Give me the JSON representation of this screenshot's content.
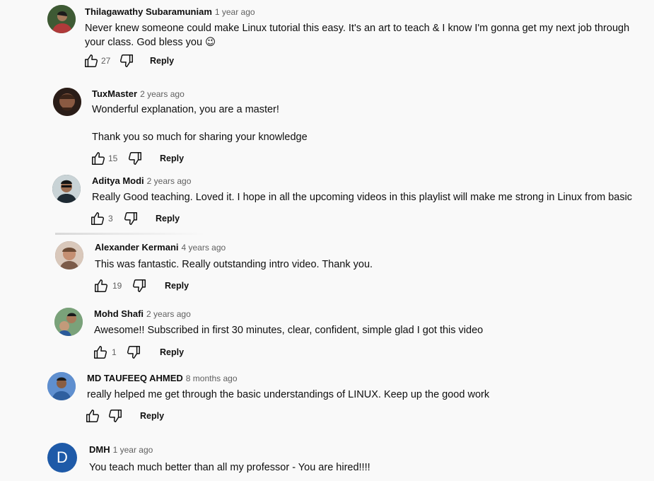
{
  "comments": [
    {
      "author": "Thilagawathy Subaramuniam",
      "time": "1 year ago",
      "text": "Never knew someone could make Linux tutorial this easy. It's an art to teach &  I know I'm gonna get my next job through your class. God bless you 😉",
      "likes": "27",
      "reply_label": "Reply",
      "avatar_color": "#4b6b3a"
    },
    {
      "author": "TuxMaster",
      "time": "2 years ago",
      "text": "Wonderful explanation, you are a master!\n\nThank you so much for sharing your knowledge",
      "likes": "15",
      "reply_label": "Reply",
      "avatar_color": "#5a3a2c"
    },
    {
      "author": "Aditya Modi",
      "time": "2 years ago",
      "text": "Really Good teaching. Loved it. I hope in all the upcoming videos in this playlist will make me strong in Linux from basic",
      "likes": "3",
      "reply_label": "Reply",
      "avatar_color": "#2b3b3f"
    },
    {
      "author": "Alexander Kermani",
      "time": "4 years ago",
      "text": "This was fantastic. Really outstanding intro video. Thank you.",
      "likes": "19",
      "reply_label": "Reply",
      "avatar_color": "#8a6a58"
    },
    {
      "author": "Mohd Shafi",
      "time": "2 years ago",
      "text": "Awesome!! Subscribed in first 30 minutes, clear, confident, simple glad I got this video",
      "likes": "1",
      "reply_label": "Reply",
      "avatar_color": "#6a8a6a"
    },
    {
      "author": "MD TAUFEEQ AHMED",
      "time": "8 months ago",
      "text": "really helped me get through the basic understandings of LINUX. Keep up the good work",
      "likes": "",
      "reply_label": "Reply",
      "avatar_color": "#3c6fb0"
    },
    {
      "author": "DMH",
      "time": "1 year ago",
      "text": "You teach much better than all my professor - You are hired!!!!",
      "likes": "",
      "reply_label": "Reply",
      "avatar_letter": "D",
      "avatar_color": "#1e5aa8"
    }
  ],
  "icons": {
    "like": "thumbs-up-icon",
    "dislike": "thumbs-down-icon"
  }
}
